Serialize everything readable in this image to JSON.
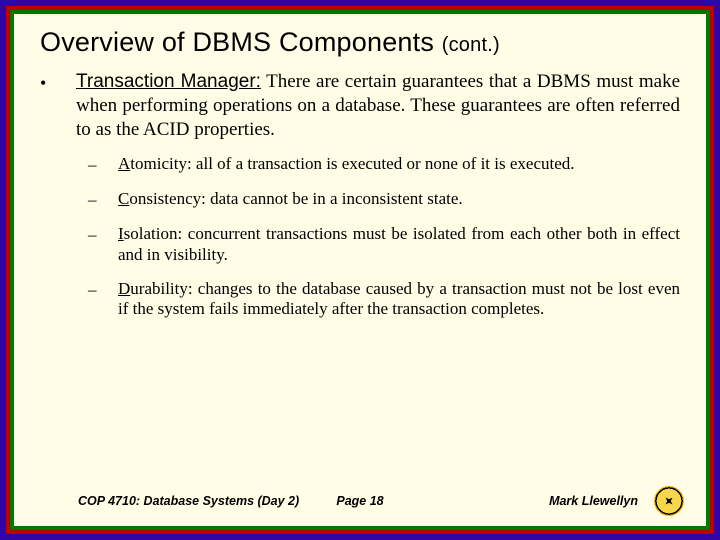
{
  "title": {
    "main": "Overview of DBMS Components",
    "cont": "(cont.)"
  },
  "bullet": {
    "marker": "•",
    "lead": "Transaction Manager:",
    "text": "  There are certain guarantees that a DBMS must make when performing operations on a database.  These guarantees are often referred to as the ACID properties."
  },
  "sub": [
    {
      "dash": "–",
      "acid": "A",
      "term": "tomicity:",
      "text": "  all of a transaction is executed or none of it is executed."
    },
    {
      "dash": "–",
      "acid": "C",
      "term": "onsistency:",
      "text": " data cannot be in a inconsistent state."
    },
    {
      "dash": "–",
      "acid": "I",
      "term": "solation:",
      "text": " concurrent transactions must be isolated from each other both in effect and in visibility."
    },
    {
      "dash": "–",
      "acid": "D",
      "term": "urability:",
      "text": " changes to the database caused by a transaction must not be lost even if the system fails immediately after the transaction completes."
    }
  ],
  "footer": {
    "left": "COP 4710: Database Systems  (Day 2)",
    "center": "Page 18",
    "right": "Mark Llewellyn"
  }
}
